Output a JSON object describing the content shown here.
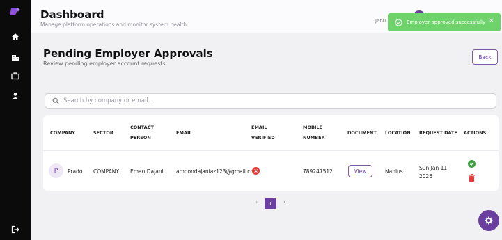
{
  "header": {
    "title": "Dashboard",
    "subtitle": "Manage platform operations and monitor system health",
    "date_partial": "Janu"
  },
  "toast": {
    "message": "Employer approved successfully",
    "close_label": "✕",
    "color": "#6fd36b"
  },
  "section": {
    "title": "Pending Employer Approvals",
    "subtitle": "Review pending employer account requests",
    "back_label": "Back"
  },
  "search": {
    "placeholder": "Search by company or email...",
    "value": ""
  },
  "table": {
    "columns": [
      {
        "line1": "COMPANY",
        "line2": ""
      },
      {
        "line1": "SECTOR",
        "line2": ""
      },
      {
        "line1": "CONTACT",
        "line2": "PERSON"
      },
      {
        "line1": "EMAIL",
        "line2": ""
      },
      {
        "line1": "EMAIL",
        "line2": "VERIFIED"
      },
      {
        "line1": "MOBILE",
        "line2": "NUMBER"
      },
      {
        "line1": "DOCUMENT",
        "line2": ""
      },
      {
        "line1": "LOCATION",
        "line2": ""
      },
      {
        "line1": "REQUEST DATE",
        "line2": ""
      },
      {
        "line1": "ACTIONS",
        "line2": ""
      }
    ],
    "rows": [
      {
        "avatar_letter": "P",
        "company": "Prado",
        "sector": "COMPANY",
        "contact": "Eman Dajani",
        "email": "amoondajaniaz123@gmail.com",
        "email_verified_icon": "x-circle-icon",
        "mobile": "789247512",
        "document_button": "View",
        "location": "Nablus",
        "date_line1": "Sun Jan 11",
        "date_line2": "2026"
      }
    ]
  },
  "pagination": {
    "prev": "‹",
    "current": "1",
    "next": "›"
  },
  "sidebar": {
    "items": [
      "logo-icon",
      "home-icon",
      "building-icon",
      "briefcase-icon",
      "user-icon",
      "logout-icon"
    ]
  },
  "colors": {
    "accent": "#6b3fa0",
    "success": "#43a047",
    "danger": "#e53935",
    "sidebar": "#0b0b0b"
  }
}
